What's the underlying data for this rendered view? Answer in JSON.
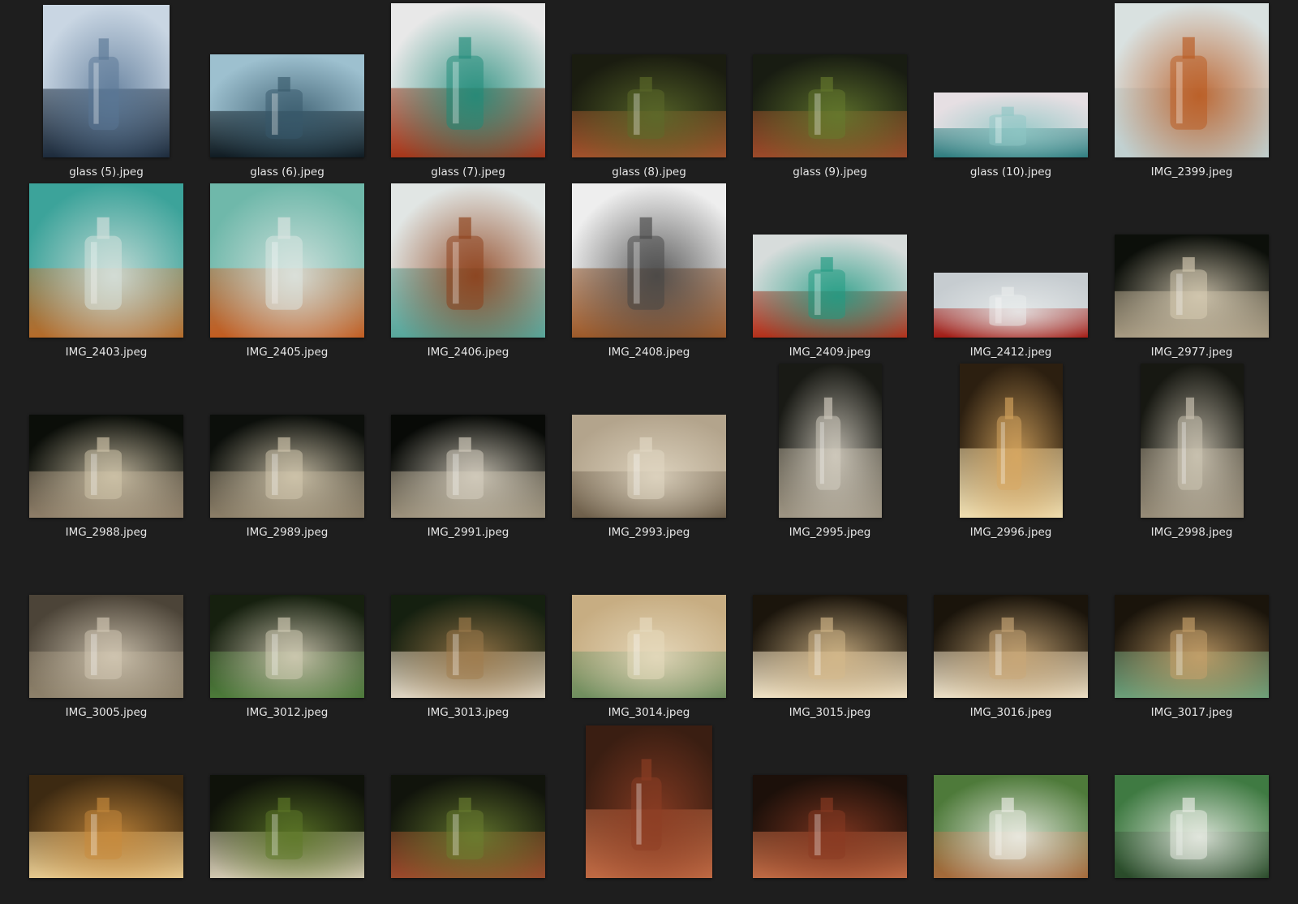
{
  "window_title": "",
  "label_color": "#e6e6e6",
  "background_color": "#1e1e1e",
  "files": [
    {
      "name": "glass (5).jpeg",
      "orientation": "portrait-ish",
      "palette": [
        "#c9d6e3",
        "#5a7796",
        "#1d2b3c"
      ],
      "subject": "clear bottles by window"
    },
    {
      "name": "glass (6).jpeg",
      "orientation": "landscape",
      "palette": [
        "#9dc0cf",
        "#36586a",
        "#101c22"
      ],
      "subject": "blue glass bottles"
    },
    {
      "name": "glass (7).jpeg",
      "orientation": "square",
      "palette": [
        "#e8e8e8",
        "#1d8a78",
        "#a5361a"
      ],
      "subject": "teal and amber bottles"
    },
    {
      "name": "glass (8).jpeg",
      "orientation": "landscape",
      "palette": [
        "#1a1c10",
        "#5c6b2a",
        "#a3522c"
      ],
      "subject": "bottle on mossy brick"
    },
    {
      "name": "glass (9).jpeg",
      "orientation": "landscape",
      "palette": [
        "#181c12",
        "#667b2e",
        "#9d4a2a"
      ],
      "subject": "bottle on mossy bricks"
    },
    {
      "name": "glass (10).jpeg",
      "orientation": "wide",
      "palette": [
        "#e6dfe3",
        "#8ec6c4",
        "#2f7d80"
      ],
      "subject": "glass pane edge"
    },
    {
      "name": "IMG_2399.jpeg",
      "orientation": "square",
      "palette": [
        "#d9e1e0",
        "#b9571c",
        "#c0cfcf"
      ],
      "subject": "amber and clear bottles"
    },
    {
      "name": "IMG_2403.jpeg",
      "orientation": "square",
      "palette": [
        "#3ca39a",
        "#d9e3df",
        "#b56b2a"
      ],
      "subject": "embossed bottles close up"
    },
    {
      "name": "IMG_2405.jpeg",
      "orientation": "square",
      "palette": [
        "#6fb8aa",
        "#dfe7e4",
        "#c25c20"
      ],
      "subject": "embossed bottle"
    },
    {
      "name": "IMG_2406.jpeg",
      "orientation": "square",
      "palette": [
        "#e1e6e4",
        "#8c3d16",
        "#57a69a"
      ],
      "subject": "brown and aqua bottles"
    },
    {
      "name": "IMG_2408.jpeg",
      "orientation": "square",
      "palette": [
        "#eeeeee",
        "#444444",
        "#9c5a2a"
      ],
      "subject": "clear bottles in mono"
    },
    {
      "name": "IMG_2409.jpeg",
      "orientation": "landscape",
      "palette": [
        "#d7dcdb",
        "#1f9a82",
        "#b3301a"
      ],
      "subject": "teal and red bottles"
    },
    {
      "name": "IMG_2412.jpeg",
      "orientation": "wide",
      "palette": [
        "#c6ccd0",
        "#e9ecec",
        "#a31b14"
      ],
      "subject": "clear and red bottles"
    },
    {
      "name": "IMG_2977.jpeg",
      "orientation": "landscape",
      "palette": [
        "#0c0f0a",
        "#d8cdb5",
        "#a99c84"
      ],
      "subject": "bottle on white cloth"
    },
    {
      "name": "IMG_2988.jpeg",
      "orientation": "landscape",
      "palette": [
        "#0b0e09",
        "#d4c8ad",
        "#8f806a"
      ],
      "subject": "bottle on cloth"
    },
    {
      "name": "IMG_2989.jpeg",
      "orientation": "landscape",
      "palette": [
        "#0c0f0b",
        "#d6cbb1",
        "#8d8069"
      ],
      "subject": "bottle on cloth"
    },
    {
      "name": "IMG_2991.jpeg",
      "orientation": "landscape",
      "palette": [
        "#080a07",
        "#d9d2c2",
        "#9e937d"
      ],
      "subject": "bottle on cloth"
    },
    {
      "name": "IMG_2993.jpeg",
      "orientation": "landscape",
      "palette": [
        "#b3a48c",
        "#e2d8c4",
        "#6e5f4a"
      ],
      "subject": "bottle in folds"
    },
    {
      "name": "IMG_2995.jpeg",
      "orientation": "portrait",
      "palette": [
        "#191a15",
        "#d5cfc2",
        "#9e9584"
      ],
      "subject": "corked bottle"
    },
    {
      "name": "IMG_2996.jpeg",
      "orientation": "portrait",
      "palette": [
        "#2c1f10",
        "#d8a760",
        "#f0dfb0"
      ],
      "subject": "corked bottle warm light"
    },
    {
      "name": "IMG_2998.jpeg",
      "orientation": "portrait",
      "palette": [
        "#171812",
        "#d0c8b6",
        "#978d79"
      ],
      "subject": "corked bottle"
    },
    {
      "name": "IMG_3005.jpeg",
      "orientation": "landscape",
      "palette": [
        "#4c4438",
        "#d6cbb6",
        "#8e826b"
      ],
      "subject": "bottle on cloth"
    },
    {
      "name": "IMG_3012.jpeg",
      "orientation": "landscape",
      "palette": [
        "#16200f",
        "#d6cfb8",
        "#4d7a3a"
      ],
      "subject": "bottle and glass"
    },
    {
      "name": "IMG_3013.jpeg",
      "orientation": "landscape",
      "palette": [
        "#152010",
        "#a07c4c",
        "#e0d6c2"
      ],
      "subject": "box and glass"
    },
    {
      "name": "IMG_3014.jpeg",
      "orientation": "landscape",
      "palette": [
        "#c7ad82",
        "#e8dcc0",
        "#6f8e5e"
      ],
      "subject": "glass on cloth"
    },
    {
      "name": "IMG_3015.jpeg",
      "orientation": "landscape",
      "palette": [
        "#1b150c",
        "#d6b98a",
        "#f0e2c4"
      ],
      "subject": "bottle and glass on cloth"
    },
    {
      "name": "IMG_3016.jpeg",
      "orientation": "landscape",
      "palette": [
        "#1a140b",
        "#caa877",
        "#ece0c6"
      ],
      "subject": "bottle and glass on cloth"
    },
    {
      "name": "IMG_3017.jpeg",
      "orientation": "landscape",
      "palette": [
        "#1a140b",
        "#c9a36b",
        "#6da07a"
      ],
      "subject": "bottle and glass on cloth"
    },
    {
      "name": "",
      "orientation": "landscape",
      "palette": [
        "#3d2a12",
        "#c98b3c",
        "#e6c98e"
      ],
      "subject": "bottle warm backdrop"
    },
    {
      "name": "",
      "orientation": "landscape",
      "palette": [
        "#0f120a",
        "#5f7a28",
        "#d2c9b0"
      ],
      "subject": "bottle on mossy brick"
    },
    {
      "name": "",
      "orientation": "landscape",
      "palette": [
        "#11140c",
        "#6b7f30",
        "#9c4a2c"
      ],
      "subject": "bottle on mossy bricks"
    },
    {
      "name": "",
      "orientation": "portrait-ish",
      "palette": [
        "#3a1e12",
        "#8e3e24",
        "#c06a44"
      ],
      "subject": "bottle in brick arch"
    },
    {
      "name": "",
      "orientation": "landscape",
      "palette": [
        "#1c100a",
        "#8a3a22",
        "#c06a44"
      ],
      "subject": "bottles in brick arch"
    },
    {
      "name": "",
      "orientation": "landscape",
      "palette": [
        "#4e7a3a",
        "#f0f0ea",
        "#a56a3a"
      ],
      "subject": "jar on window sill"
    },
    {
      "name": "",
      "orientation": "landscape",
      "palette": [
        "#3f7a42",
        "#eef0ea",
        "#2a4a2a"
      ],
      "subject": "spice tin and jars"
    }
  ]
}
